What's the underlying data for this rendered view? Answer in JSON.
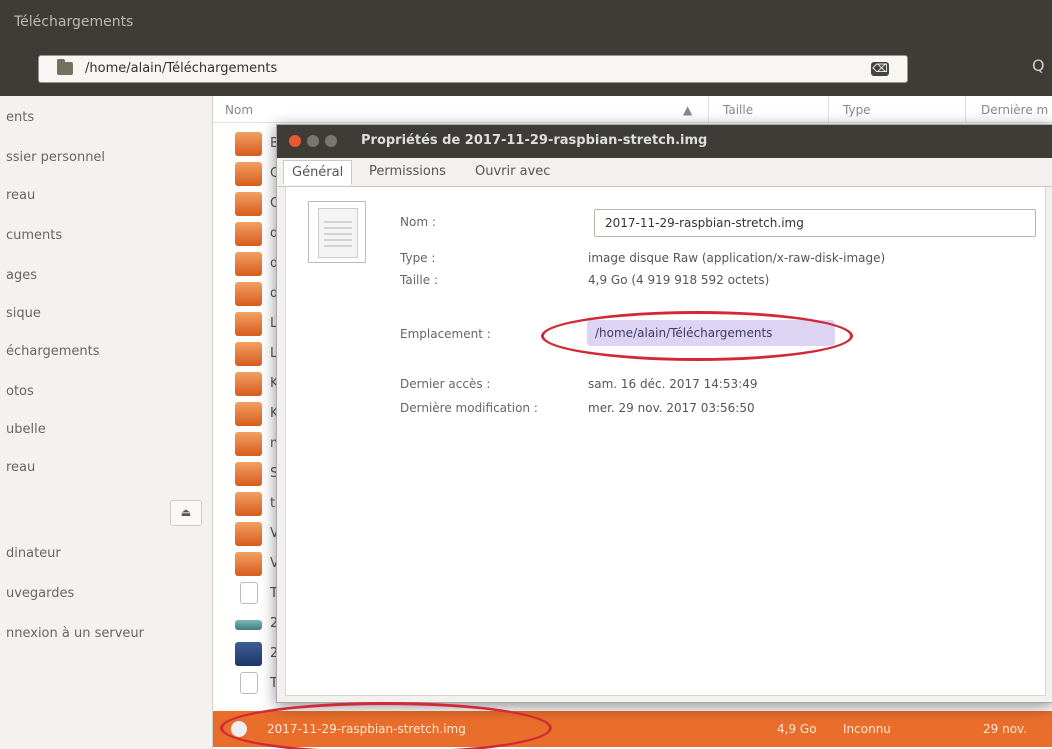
{
  "window": {
    "title": "Téléchargements"
  },
  "toolbar": {
    "path": "/home/alain/Téléchargements",
    "clear_symbol": "⌫",
    "search_symbol": "Q"
  },
  "sidebar": {
    "items": [
      "ents",
      "ssier personnel",
      "reau",
      "cuments",
      "ages",
      "sique",
      "échargements",
      "otos",
      "ubelle",
      "reau",
      "dinateur",
      "uvegardes",
      "nnexion à un serveur"
    ],
    "eject_symbol": "⏏"
  },
  "file_list": {
    "columns": {
      "name": "Nom",
      "size": "Taille",
      "type": "Type",
      "modified": "Dernière m"
    },
    "sort_arrow": "▲",
    "rows": [
      {
        "letter": "B",
        "icon": "folder"
      },
      {
        "letter": "C",
        "icon": "folder"
      },
      {
        "letter": "C",
        "icon": "folder"
      },
      {
        "letter": "d",
        "icon": "folder"
      },
      {
        "letter": "d",
        "icon": "folder"
      },
      {
        "letter": "d",
        "icon": "folder"
      },
      {
        "letter": "L",
        "icon": "folder"
      },
      {
        "letter": "L",
        "icon": "folder"
      },
      {
        "letter": "K",
        "icon": "folder"
      },
      {
        "letter": "K",
        "icon": "folder"
      },
      {
        "letter": "n",
        "icon": "folder"
      },
      {
        "letter": "S",
        "icon": "folder"
      },
      {
        "letter": "t",
        "icon": "folder"
      },
      {
        "letter": "V",
        "icon": "folder"
      },
      {
        "letter": "V",
        "icon": "folder"
      },
      {
        "letter": "T",
        "icon": "document"
      },
      {
        "letter": "2",
        "icon": "network"
      },
      {
        "letter": "2",
        "icon": "disk"
      },
      {
        "letter": "T",
        "icon": "document"
      }
    ],
    "selected": {
      "name": "2017-11-29-raspbian-stretch.img",
      "size": "4,9 Go",
      "type": "Inconnu",
      "date": "29 nov."
    }
  },
  "dialog": {
    "title": "Propriétés de 2017-11-29-raspbian-stretch.img",
    "tabs": [
      "Général",
      "Permissions",
      "Ouvrir avec"
    ],
    "fields": {
      "name_label": "Nom :",
      "name_value": "2017-11-29-raspbian-stretch.img",
      "type_label": "Type :",
      "type_value": "image disque Raw (application/x-raw-disk-image)",
      "size_label": "Taille :",
      "size_value": "4,9 Go (4 919 918 592 octets)",
      "location_label": "Emplacement :",
      "location_value": "/home/alain/Téléchargements",
      "access_label": "Dernier accès :",
      "access_value": "sam. 16 déc. 2017 14:53:49",
      "modified_label": "Dernière modification :",
      "modified_value": "mer. 29 nov. 2017 03:56:50"
    }
  },
  "colors": {
    "accent": "#e96d2b",
    "titlebar": "#3d3c37",
    "annotation": "#d22936"
  }
}
